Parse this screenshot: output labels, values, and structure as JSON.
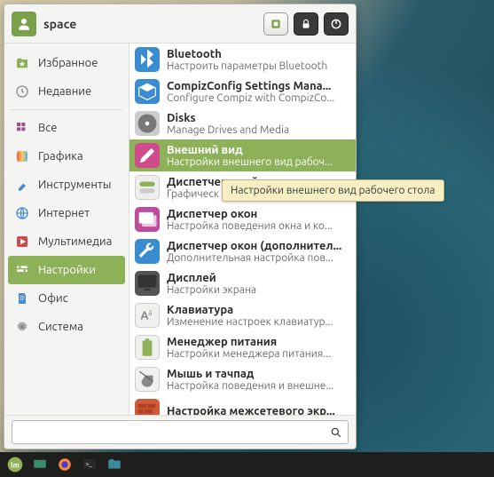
{
  "header": {
    "username": "space"
  },
  "sidebar": {
    "items": [
      {
        "label": "Избранное"
      },
      {
        "label": "Недавние"
      },
      {
        "label": "Все"
      },
      {
        "label": "Графика"
      },
      {
        "label": "Инструменты"
      },
      {
        "label": "Интернет"
      },
      {
        "label": "Мультимедиа"
      },
      {
        "label": "Настройки"
      },
      {
        "label": "Офис"
      },
      {
        "label": "Система"
      }
    ]
  },
  "apps": [
    {
      "title": "Bluetooth",
      "desc": "Настроить параметры Bluetooth"
    },
    {
      "title": "CompizConfig Settings Mana...",
      "desc": "Configure Compiz with CompizCo..."
    },
    {
      "title": "Disks",
      "desc": "Manage Drives and Media"
    },
    {
      "title": "Внешний вид",
      "desc": "Настройки внешнего вид рабоч..."
    },
    {
      "title": "Диспетчер драйверов",
      "desc": "Графическ"
    },
    {
      "title": "Диспетчер окон",
      "desc": "Настройка поведения окна и ко..."
    },
    {
      "title": "Диспетчер окон (дополнител...",
      "desc": "Дополнительная настройка пов..."
    },
    {
      "title": "Дисплей",
      "desc": "Настройки экрана"
    },
    {
      "title": "Клавиатура",
      "desc": "Изменение настроек клавиатур..."
    },
    {
      "title": "Менеджер питания",
      "desc": "Настройки менеджера питания..."
    },
    {
      "title": "Мышь и тачпад",
      "desc": "Настройка поведения и внешне..."
    },
    {
      "title": "Настройка межсетевого экр...",
      "desc": ""
    }
  ],
  "tooltip": "Настройки внешнего вид рабочего стола",
  "search": {
    "value": ""
  },
  "colors": {
    "accent": "#8cb158"
  }
}
